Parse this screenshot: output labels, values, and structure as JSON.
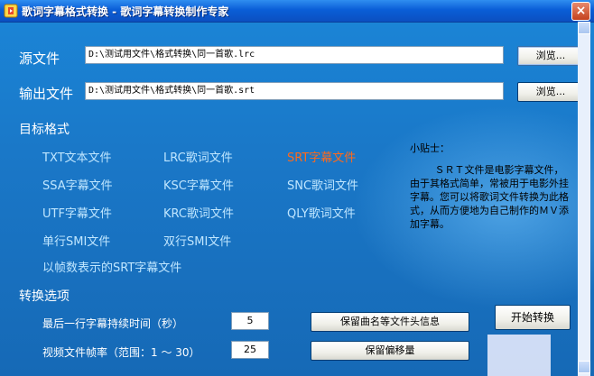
{
  "window": {
    "title": "歌词字幕格式转换 - 歌词字幕转换制作专家",
    "close_label": "×"
  },
  "source": {
    "label": "源文件",
    "value": "D:\\测试用文件\\格式转换\\同一首歌.lrc",
    "browse_label": "浏览..."
  },
  "output": {
    "label": "输出文件",
    "value": "D:\\测试用文件\\格式转换\\同一首歌.srt",
    "browse_label": "浏览..."
  },
  "target_format": {
    "heading": "目标格式",
    "options": [
      {
        "label": "TXT文本文件",
        "selected": false
      },
      {
        "label": "LRC歌词文件",
        "selected": false
      },
      {
        "label": "SRT字幕文件",
        "selected": true
      },
      {
        "label": "SSA字幕文件",
        "selected": false
      },
      {
        "label": "KSC字幕文件",
        "selected": false
      },
      {
        "label": "SNC歌词文件",
        "selected": false
      },
      {
        "label": "UTF字幕文件",
        "selected": false
      },
      {
        "label": "KRC歌词文件",
        "selected": false
      },
      {
        "label": "QLY歌词文件",
        "selected": false
      },
      {
        "label": "单行SMI文件",
        "selected": false
      },
      {
        "label": "双行SMI文件",
        "selected": false
      },
      {
        "label": "以帧数表示的SRT字幕文件",
        "selected": false
      }
    ]
  },
  "tips": {
    "title": "小贴士：",
    "body": "ＳＲＴ文件是电影字幕文件，由于其格式简单，常被用于电影外挂字幕。您可以将歌词文件转换为此格式，从而方便地为自己制作的ＭＶ添加字幕。"
  },
  "convert_options": {
    "heading": "转换选项",
    "last_line_label": "最后一行字幕持续时间（秒）",
    "last_line_value": "5",
    "frame_rate_label": "视频文件帧率（范围：1 ～ 30）",
    "frame_rate_value": "25",
    "keep_header_button": "保留曲名等文件头信息",
    "keep_offset_button": "保留偏移量",
    "start_button": "开始转换"
  },
  "colors": {
    "background": "#1a78c8",
    "option_text": "#bfe6ff",
    "selected_option": "#ff6a1a",
    "titlebar": "#0a5ed7"
  }
}
